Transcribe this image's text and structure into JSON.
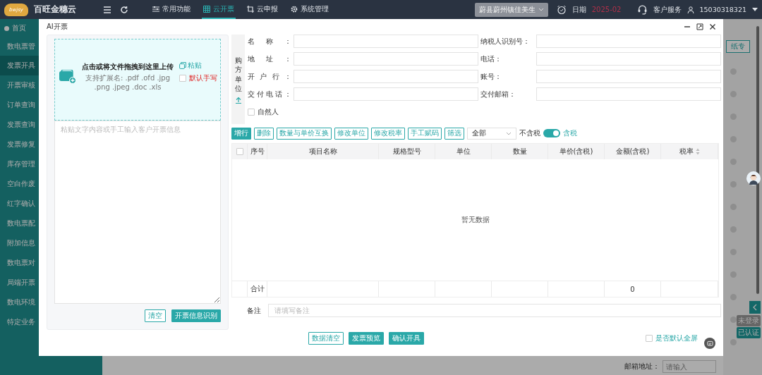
{
  "topbar": {
    "brand": "百旺金穗云",
    "logo_text": "bwjsy",
    "nav": [
      {
        "label": "常用功能",
        "selected": false,
        "kind": "sliders"
      },
      {
        "label": "云开票",
        "selected": true,
        "kind": "grid"
      },
      {
        "label": "云申报",
        "selected": false,
        "kind": "crop"
      },
      {
        "label": "系统管理",
        "selected": false,
        "kind": "gear"
      }
    ],
    "company": "蔚县蔚州镇佳美生",
    "date_label": "日期",
    "date": "2025-02",
    "service": "客户服务",
    "user": "15030318321"
  },
  "sidebar": {
    "home": "首页",
    "group": "数电票管",
    "items": [
      {
        "label": "发票开具",
        "selected": true
      },
      {
        "label": "开票审核",
        "selected": false
      },
      {
        "label": "订单查询",
        "selected": false
      },
      {
        "label": "发票查询",
        "selected": false
      },
      {
        "label": "发票修复",
        "selected": false
      },
      {
        "label": "库存管理",
        "selected": false
      },
      {
        "label": "空白作废",
        "selected": false
      },
      {
        "label": "红字确认",
        "selected": false
      },
      {
        "label": "数电票配",
        "selected": false
      },
      {
        "label": "附加信息",
        "selected": false
      },
      {
        "label": "数电票对",
        "selected": false
      },
      {
        "label": "局端开票",
        "selected": false
      },
      {
        "label": "数电环境",
        "selected": false
      },
      {
        "label": "特定业务",
        "selected": false
      }
    ]
  },
  "background": {
    "paper_button": "纸专",
    "badges": [
      "未登录",
      "已认证"
    ],
    "email_label": "邮箱地址：",
    "email_placeholder": "请输入"
  },
  "modal": {
    "title": "AI开票",
    "upload": {
      "title": "点击或将文件拖拽到这里上传",
      "hint": "支持扩展名: .pdf .ofd .jpg .png .jpeg .doc .xls",
      "paste": "粘贴",
      "default_handwrite": {
        "label": "默认手写",
        "checked": false
      }
    },
    "textarea_placeholder": "粘贴文字内容或手工输入客户开票信息",
    "left_buttons": [
      {
        "label": "清空",
        "kind": "outline"
      },
      {
        "label": "开票信息识别",
        "kind": "primary"
      }
    ],
    "buyer": {
      "section_label": "购方单位",
      "fields": [
        {
          "label": "名称："
        },
        {
          "label": "纳税人识别号："
        },
        {
          "label": "地址："
        },
        {
          "label": "电话："
        },
        {
          "label": "开户行："
        },
        {
          "label": "账号："
        },
        {
          "label": "交付电话："
        },
        {
          "label": "交付邮箱："
        }
      ],
      "natural_person": {
        "label": "自然人",
        "checked": false
      }
    },
    "toolbar": [
      {
        "label": "增行",
        "kind": "primary"
      },
      {
        "label": "删除",
        "kind": "outline"
      },
      {
        "label": "数量与单价互换",
        "kind": "outline"
      },
      {
        "label": "修改单位",
        "kind": "outline"
      },
      {
        "label": "修改税率",
        "kind": "outline"
      },
      {
        "label": "手工赋码",
        "kind": "outline"
      },
      {
        "label": "筛选",
        "kind": "outline"
      }
    ],
    "filter_select": "全部",
    "tax_toggle": {
      "off_label": "不含税",
      "on_label": "含税",
      "on": true
    },
    "table": {
      "select_all_checked": false,
      "columns": [
        "序号",
        "项目名称",
        "规格型号",
        "单位",
        "数量",
        "单价(含税)",
        "金额(含税)",
        "税率"
      ],
      "empty": "暂无数据",
      "total_label": "合计",
      "total_amount": "0"
    },
    "remark": {
      "label": "备注",
      "placeholder": "请填写备注"
    },
    "footer_buttons": [
      {
        "label": "数据清空",
        "kind": "outline"
      },
      {
        "label": "发票预览",
        "kind": "primary"
      },
      {
        "label": "确认开具",
        "kind": "primary"
      }
    ],
    "fullscreen_default": {
      "label": "是否默认全屏",
      "checked": false
    }
  }
}
